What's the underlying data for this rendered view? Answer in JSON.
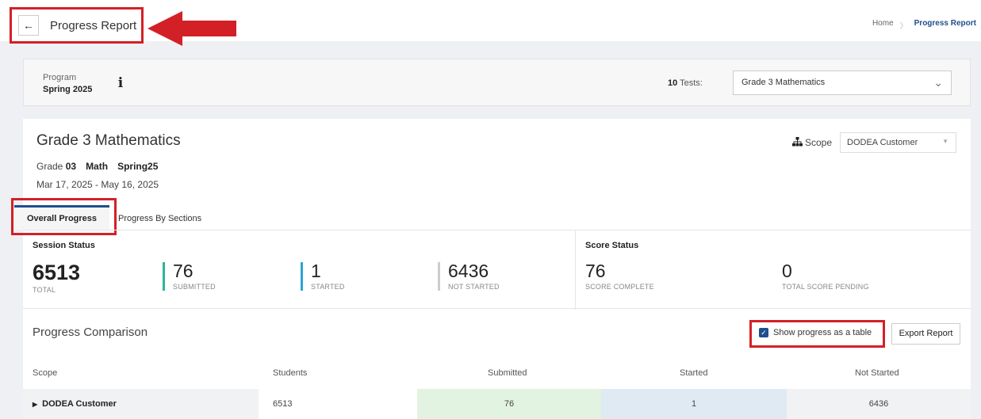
{
  "header": {
    "back_icon": "arrow-left-icon",
    "title": "Progress Report",
    "breadcrumb": {
      "home": "Home",
      "separator": "〉",
      "current": "Progress Report"
    }
  },
  "program": {
    "label": "Program",
    "name": "Spring 2025",
    "info_icon": "info-icon",
    "tests_count": "10",
    "tests_label": "Tests:",
    "selected_test": "Grade 3 Mathematics"
  },
  "test": {
    "title": "Grade 3 Mathematics",
    "grade_label": "Grade",
    "grade_value": "03",
    "subject": "Math",
    "term": "Spring25",
    "dates": "Mar 17, 2025 - May 16, 2025",
    "scope_label": "Scope",
    "scope_value": "DODEA Customer"
  },
  "tabs": [
    {
      "label": "Overall Progress",
      "active": true
    },
    {
      "label": "Progress By Sections",
      "active": false
    }
  ],
  "session_status": {
    "label": "Session Status",
    "total": {
      "value": "6513",
      "label": "TOTAL"
    },
    "submitted": {
      "value": "76",
      "label": "SUBMITTED",
      "color": "#2bb5a0"
    },
    "started": {
      "value": "1",
      "label": "STARTED",
      "color": "#2aa6d6"
    },
    "not_started": {
      "value": "6436",
      "label": "NOT STARTED",
      "color": "#cccccc"
    }
  },
  "score_status": {
    "label": "Score Status",
    "complete": {
      "value": "76",
      "label": "SCORE COMPLETE"
    },
    "pending": {
      "value": "0",
      "label": "TOTAL SCORE PENDING"
    }
  },
  "comparison": {
    "title": "Progress Comparison",
    "table_toggle_label": "Show progress as a table",
    "table_toggle_checked": true,
    "export_label": "Export Report",
    "columns": [
      "Scope",
      "Students",
      "Submitted",
      "Started",
      "Not Started"
    ],
    "rows": [
      {
        "scope": "DODEA Customer",
        "students": "6513",
        "submitted": "76",
        "started": "1",
        "not_started": "6436"
      }
    ]
  },
  "colors": {
    "annotation": "#d32027",
    "accent": "#1f4e8c",
    "submitted_cell": "#e3f3e1",
    "started_cell": "#dfeaf3",
    "not_started_cell": "#f1f2f4"
  }
}
